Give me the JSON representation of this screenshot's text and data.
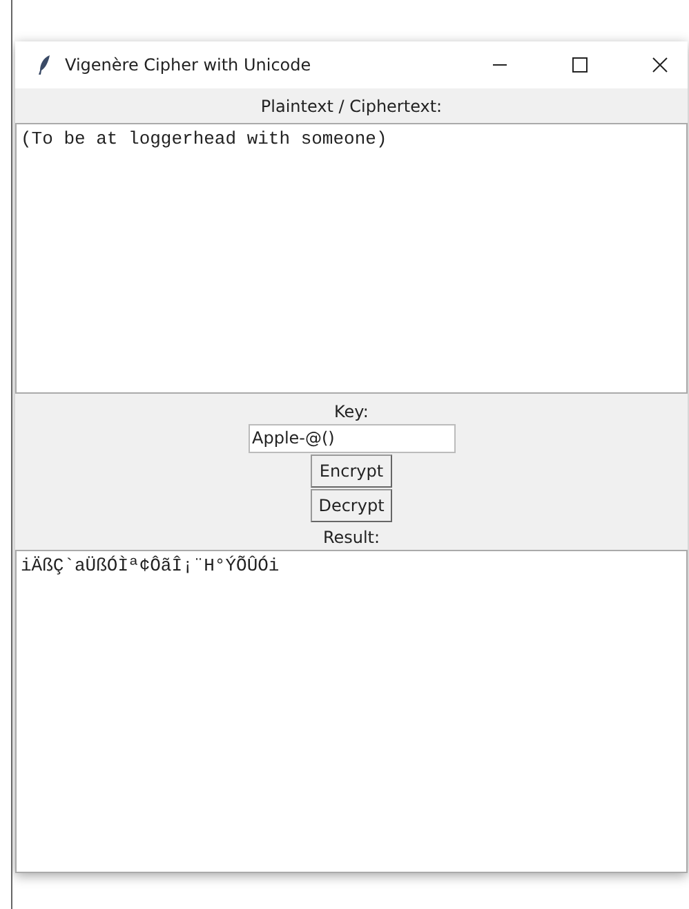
{
  "window": {
    "title": "Vigenère Cipher with Unicode"
  },
  "input_label": "Plaintext / Ciphertext:",
  "input_text": "(To be at loggerhead with someone)",
  "key_label": "Key:",
  "key_value": "Apple-@()",
  "buttons": [
    "Encrypt",
    "Decrypt"
  ],
  "result_label": "Result:",
  "result_text": "iÄßÇ`aÜßÓÌª¢ÔãÎ¡¨H°ÝÕÛÓi"
}
